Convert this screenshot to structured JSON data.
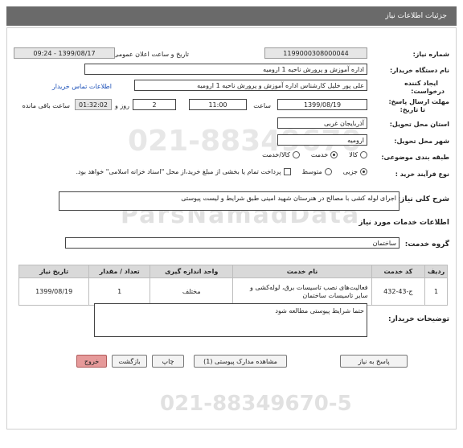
{
  "header": {
    "title": "جزئیات اطلاعات نیاز"
  },
  "fields": {
    "need_number_label": "شماره نیاز:",
    "need_number": "1199000308000044",
    "announce_label": "تاریخ و ساعت اعلان عمومی:",
    "announce_value": "1399/08/17 - 09:24",
    "buyer_org_label": "نام دستگاه خریدار:",
    "buyer_org": "اداره آموزش و پرورش ناحیه 1 ارومیه",
    "requester_label_1": "ایجاد کننده",
    "requester_label_2": "درخواست:",
    "requester": "علی پور خلیل کارشناس اداره آموزش و پرورش ناحیه 1 ارومیه",
    "contact_link": "اطلاعات تماس خریدار",
    "deadline_label_1": "مهلت ارسال پاسخ:",
    "deadline_label_2": "تا تاریخ:",
    "deadline_date": "1399/08/19",
    "time_label": "ساعت",
    "deadline_time": "11:00",
    "days_value": "2",
    "days_label": "روز و",
    "remaining_time": "01:32:02",
    "remaining_label": "ساعت باقی مانده",
    "province_label": "استان محل تحویل:",
    "province": "آذربایجان غربی",
    "city_label": "شهر محل تحویل:",
    "city": "ارومیه",
    "category_label": "طبقه بندی موضوعی:",
    "category_options": [
      "کالا",
      "خدمت",
      "کالا/خدمت"
    ],
    "process_label": "نوع فرآیند خرید :",
    "process_options": [
      "جزیی",
      "متوسط"
    ],
    "payment_note": "پرداخت تمام یا بخشی از مبلغ خرید،از محل \"اسناد خزانه اسلامی\" خواهد بود."
  },
  "summary": {
    "label": "شرح کلی نیاز:",
    "value": "اجرای لوله کشی با مصالح در هنرستان شهید امینی طبق شرایط و لیست پیوستی"
  },
  "services": {
    "section_title": "اطلاعات خدمات مورد نیاز",
    "group_label": "گروه خدمت:",
    "group_value": "ساختمان",
    "table_headers": [
      "ردیف",
      "کد خدمت",
      "نام خدمت",
      "واحد اندازه گیری",
      "تعداد / مقدار",
      "تاریخ نیاز"
    ],
    "rows": [
      {
        "row": "1",
        "code": "ج-43-432",
        "name": "فعالیت‌های نصب تاسیسات برق، لوله‌کشی و سایر تاسیسات ساختمان",
        "unit": "مختلف",
        "qty": "1",
        "date": "1399/08/19"
      }
    ]
  },
  "buyer_notes": {
    "label": "توضیحات خریدار:",
    "value": "حتما شرایط پیوستی مطالعه شود"
  },
  "watermark": {
    "phone_top": "021-88349670",
    "site": "ParsNamadData",
    "phone_bottom": "021-88349670-5"
  },
  "buttons": {
    "reply": "پاسخ به نیاز",
    "attachments": "مشاهده مدارک پیوستی (1)",
    "print": "چاپ",
    "back": "بازگشت",
    "exit": "خروج"
  }
}
